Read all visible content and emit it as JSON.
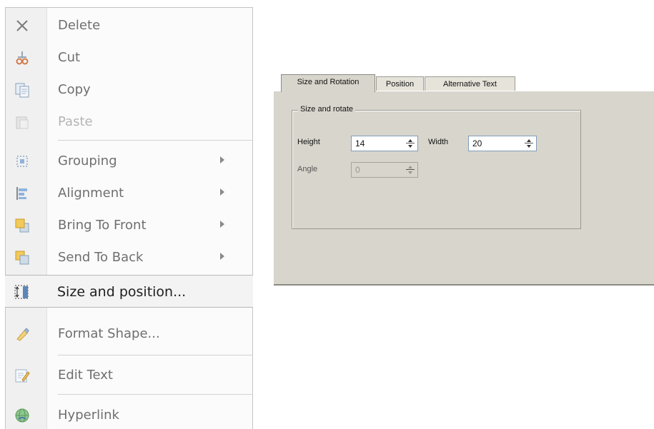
{
  "context_menu": {
    "items": [
      {
        "label": "Delete",
        "icon": "delete-icon",
        "disabled": false,
        "submenu": false
      },
      {
        "label": "Cut",
        "icon": "cut-icon",
        "disabled": false,
        "submenu": false
      },
      {
        "label": "Copy",
        "icon": "copy-icon",
        "disabled": false,
        "submenu": false
      },
      {
        "label": "Paste",
        "icon": "paste-icon",
        "disabled": true,
        "submenu": false
      },
      {
        "label": "Grouping",
        "icon": "grouping-icon",
        "disabled": false,
        "submenu": true
      },
      {
        "label": "Alignment",
        "icon": "alignment-icon",
        "disabled": false,
        "submenu": true
      },
      {
        "label": "Bring To Front",
        "icon": "bring-to-front-icon",
        "disabled": false,
        "submenu": true
      },
      {
        "label": "Send To Back",
        "icon": "send-to-back-icon",
        "disabled": false,
        "submenu": true
      },
      {
        "label": "Size and position...",
        "icon": "size-position-icon",
        "disabled": false,
        "submenu": false,
        "highlighted": true
      },
      {
        "label": "Format Shape...",
        "icon": "format-shape-icon",
        "disabled": false,
        "submenu": false
      },
      {
        "label": "Edit Text",
        "icon": "edit-text-icon",
        "disabled": false,
        "submenu": false
      },
      {
        "label": "Hyperlink",
        "icon": "hyperlink-icon",
        "disabled": false,
        "submenu": false
      }
    ]
  },
  "dialog": {
    "tabs": [
      "Size and Rotation",
      "Position",
      "Alternative Text"
    ],
    "active_tab": "Size and Rotation",
    "group_title": "Size and rotate",
    "height_label": "Height",
    "height_value": "14",
    "width_label": "Width",
    "width_value": "20",
    "angle_label": "Angle",
    "angle_value": "0"
  }
}
